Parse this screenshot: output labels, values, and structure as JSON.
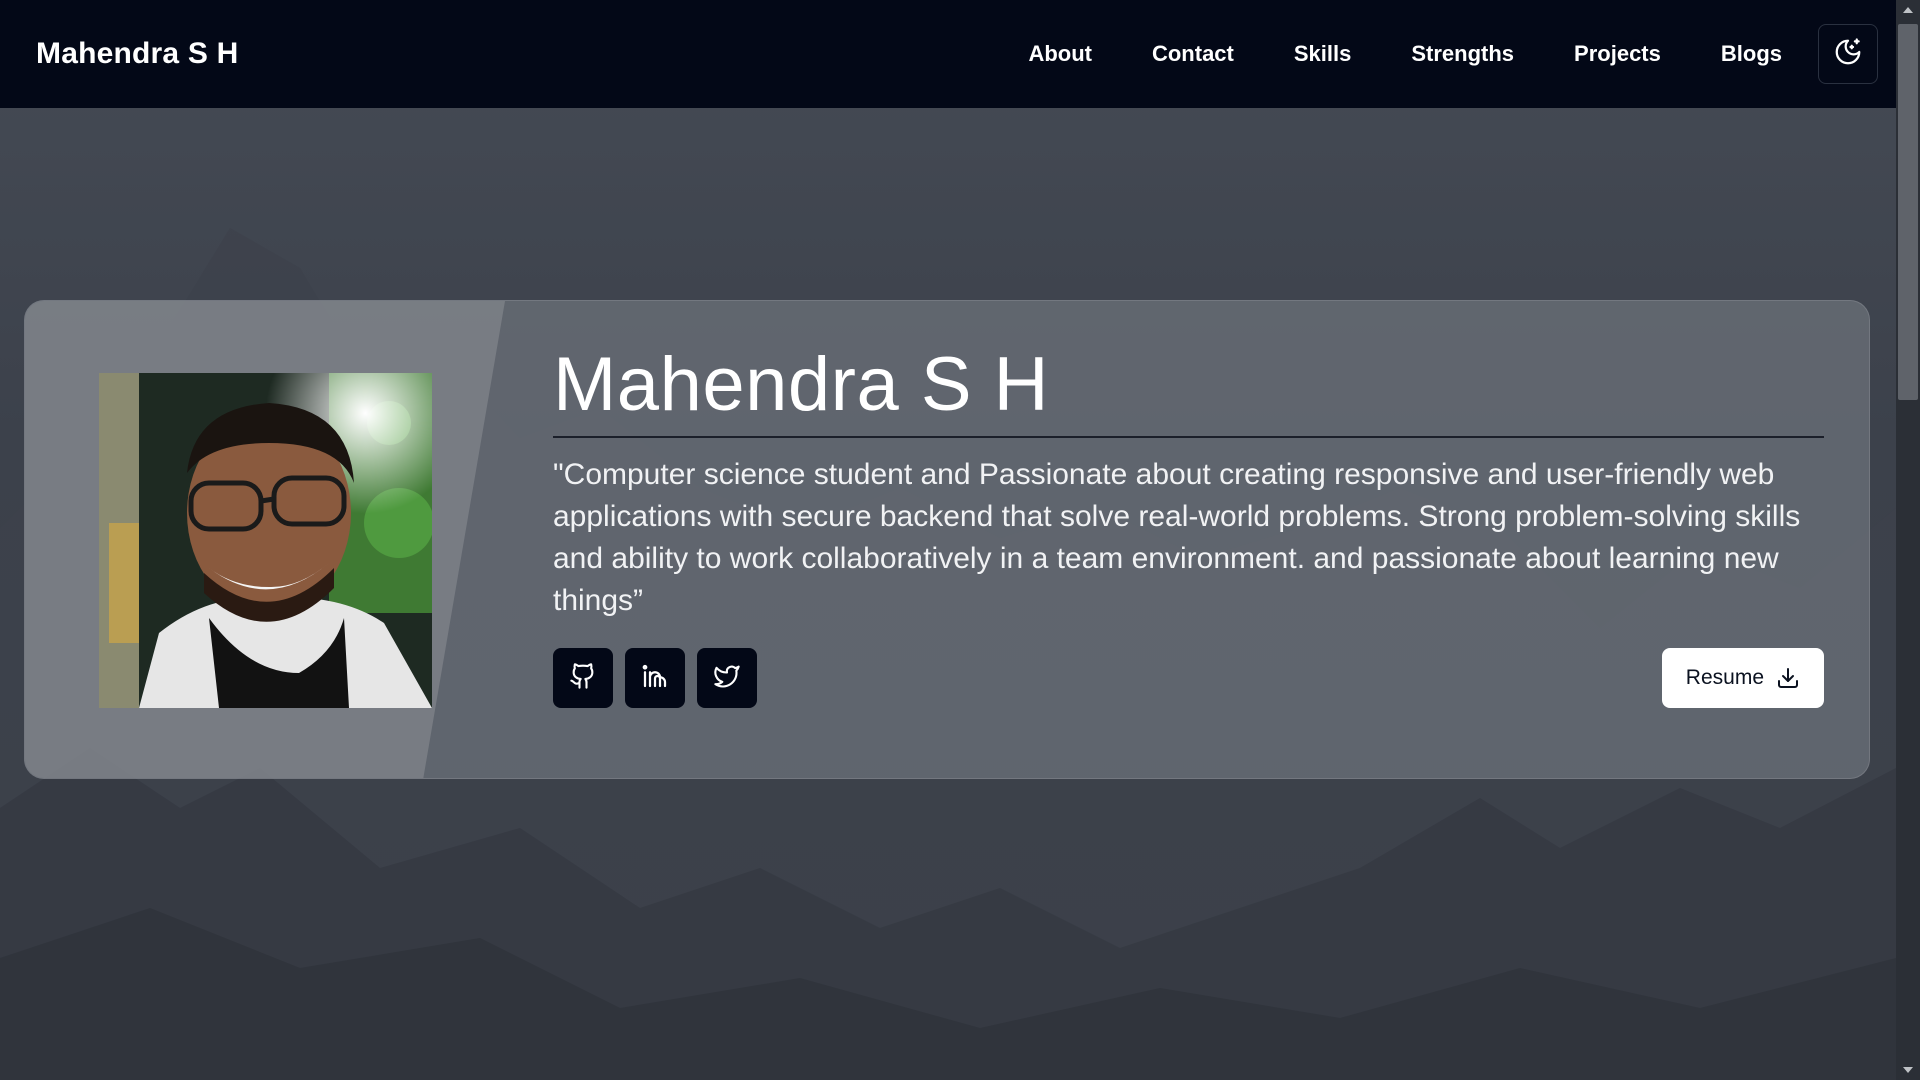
{
  "navbar": {
    "brand": "Mahendra S H",
    "links": [
      {
        "label": "About"
      },
      {
        "label": "Contact"
      },
      {
        "label": "Skills"
      },
      {
        "label": "Strengths"
      },
      {
        "label": "Projects"
      },
      {
        "label": "Blogs"
      }
    ],
    "theme_toggle_icon": "moon-stars-icon"
  },
  "hero": {
    "name": "Mahendra S H",
    "bio": "\"Computer science student and Passionate about creating responsive and user-friendly web applications with secure backend that solve real-world problems. Strong problem-solving skills and ability to work collaboratively in a team environment. and passionate about learning new things”",
    "social": [
      {
        "icon": "github-icon"
      },
      {
        "icon": "linkedin-icon"
      },
      {
        "icon": "twitter-icon"
      }
    ],
    "resume_label": "Resume",
    "resume_icon": "download-icon"
  },
  "colors": {
    "navbar_bg": "#030817",
    "card_bg": "#6e737b",
    "page_bg": "#3a3f49",
    "button_dark": "#030817",
    "button_light": "#ffffff"
  }
}
